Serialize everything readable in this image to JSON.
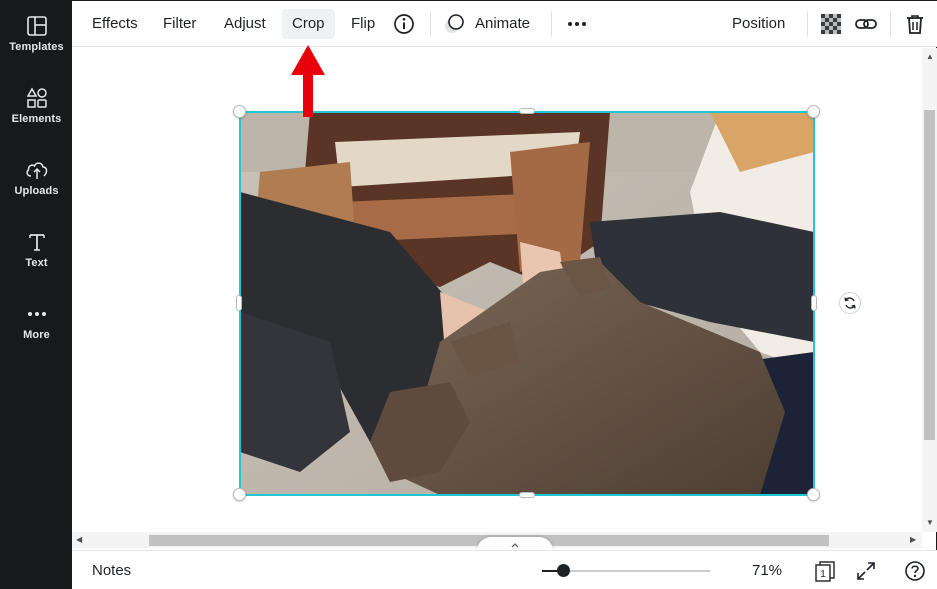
{
  "sidebar": {
    "items": [
      {
        "label": "Templates",
        "icon": "templates-icon"
      },
      {
        "label": "Elements",
        "icon": "elements-icon"
      },
      {
        "label": "Uploads",
        "icon": "uploads-icon"
      },
      {
        "label": "Text",
        "icon": "text-icon"
      },
      {
        "label": "More",
        "icon": "more-icon"
      }
    ]
  },
  "toolbar": {
    "effects": "Effects",
    "filter": "Filter",
    "adjust": "Adjust",
    "crop": "Crop",
    "flip": "Flip",
    "animate": "Animate",
    "position": "Position",
    "icons": [
      "info-icon",
      "animate-icon",
      "more-options-icon",
      "transparency-icon",
      "link-icon",
      "trash-icon"
    ]
  },
  "canvas": {
    "selection_color": "#1fc7d4",
    "annotation_color": "#e8000b"
  },
  "bottombar": {
    "notes": "Notes",
    "zoom": "71%",
    "zoom_level": 0.71,
    "page_count": "1"
  }
}
